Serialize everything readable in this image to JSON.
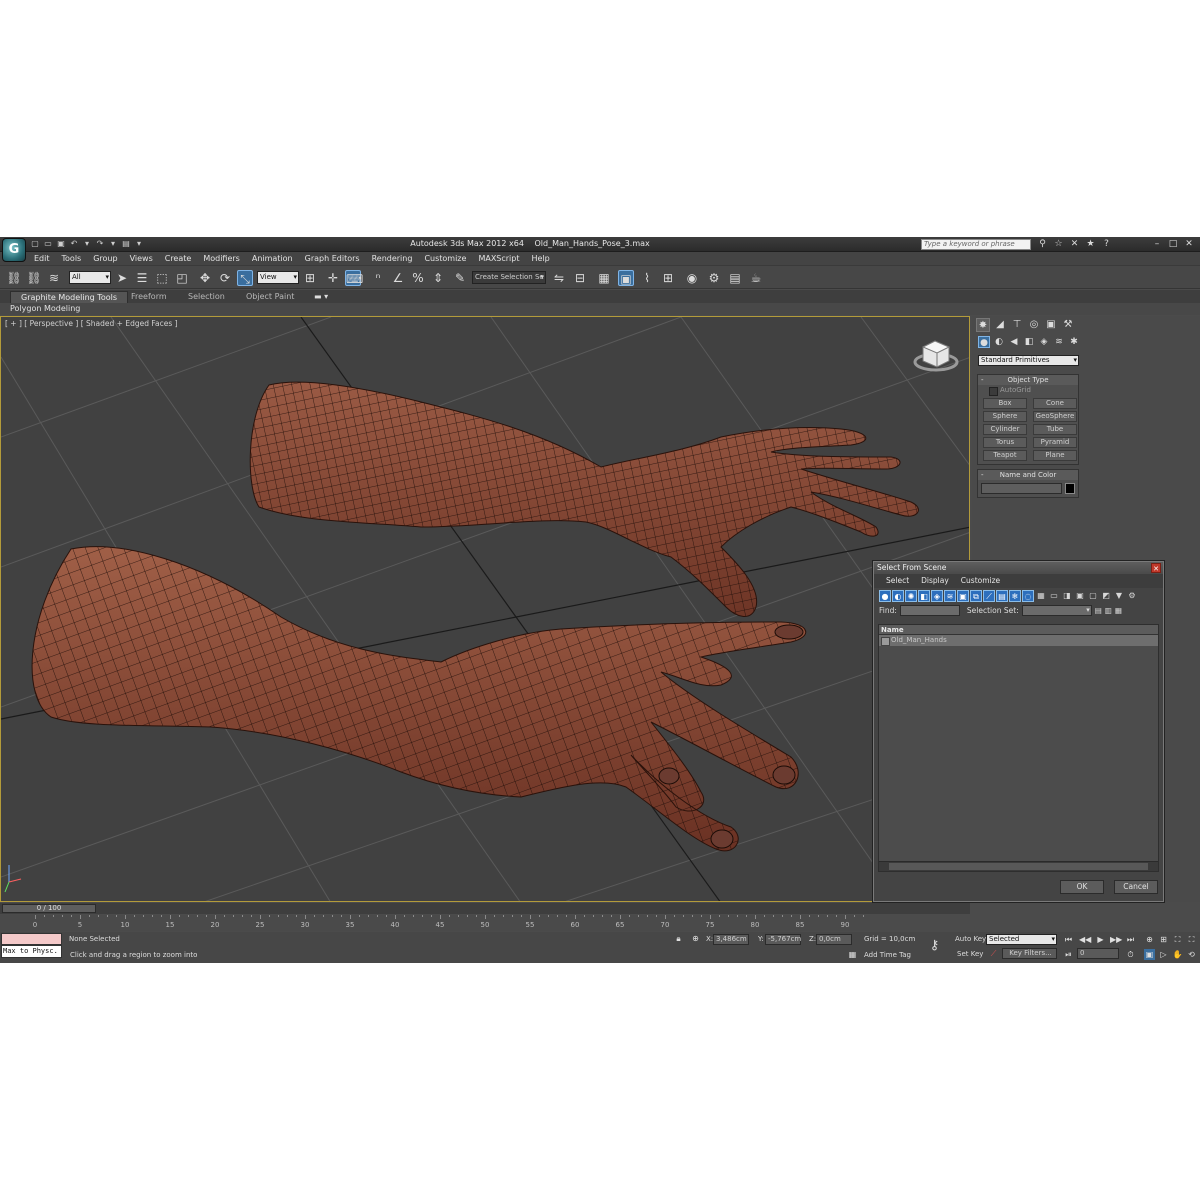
{
  "titlebar": {
    "app_title": "Autodesk 3ds Max  2012 x64",
    "file_name": "Old_Man_Hands_Pose_3.max",
    "search_placeholder": "Type a keyword or phrase"
  },
  "menu": [
    "Edit",
    "Tools",
    "Group",
    "Views",
    "Create",
    "Modifiers",
    "Animation",
    "Graph Editors",
    "Rendering",
    "Customize",
    "MAXScript",
    "Help"
  ],
  "toolbar": {
    "selection_filter": "All",
    "ref_coord": "View",
    "named_selection": "Create Selection Se"
  },
  "ribbon": {
    "tabs": [
      "Graphite Modeling Tools",
      "Freeform",
      "Selection",
      "Object Paint"
    ],
    "panel": "Polygon Modeling"
  },
  "viewport": {
    "label": "[ + ] [ Perspective ] [ Shaded + Edged Faces ]"
  },
  "command_panel": {
    "category": "Standard Primitives",
    "object_type_title": "Object Type",
    "autogrid": "AutoGrid",
    "buttons": [
      "Box",
      "Cone",
      "Sphere",
      "GeoSphere",
      "Cylinder",
      "Tube",
      "Torus",
      "Pyramid",
      "Teapot",
      "Plane"
    ],
    "name_color_title": "Name and Color"
  },
  "dialog": {
    "title": "Select From Scene",
    "menu": [
      "Select",
      "Display",
      "Customize"
    ],
    "find_label": "Find:",
    "selection_set_label": "Selection Set:",
    "column_name": "Name",
    "items": [
      "Old_Man_Hands"
    ],
    "ok": "OK",
    "cancel": "Cancel"
  },
  "timeline": {
    "slider": "0 / 100",
    "ticks": [
      "0",
      "5",
      "10",
      "15",
      "20",
      "25",
      "30",
      "35",
      "40",
      "45",
      "50",
      "55",
      "60",
      "65",
      "70",
      "75",
      "80",
      "85",
      "90"
    ]
  },
  "status": {
    "script_listener": "Max to Physc.",
    "selection_status": "None Selected",
    "prompt": "Click and drag a region to zoom into",
    "x_label": "X:",
    "x_value": "3,486cm",
    "y_label": "Y:",
    "y_value": "-5,767cm",
    "z_label": "Z:",
    "z_value": "0,0cm",
    "grid": "Grid = 10,0cm",
    "add_time_tag": "Add Time Tag",
    "auto_key": "Auto Key",
    "set_key": "Set Key",
    "key_mode": "Selected",
    "key_filters": "Key Filters...",
    "frame": "0"
  },
  "colors": {
    "viewport_bg": "#414141",
    "active_border": "#b39b3a",
    "skin": "#8a4a36",
    "selection_blue": "#2d6fbd"
  }
}
